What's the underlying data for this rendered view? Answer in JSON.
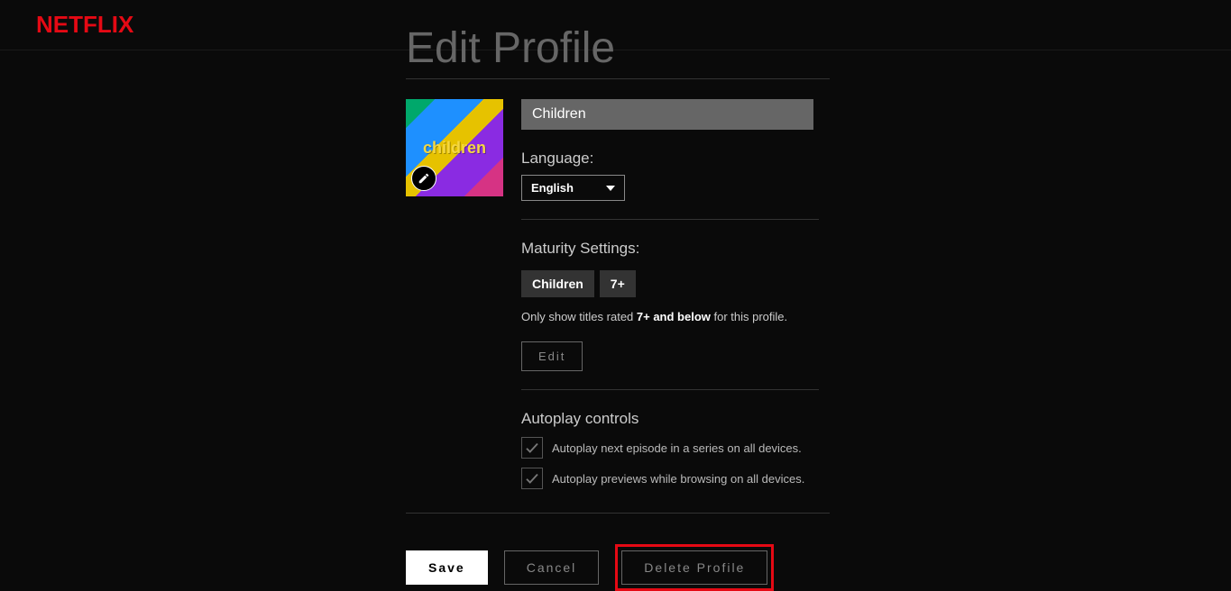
{
  "brand": "NETFLIX",
  "page_title": "Edit Profile",
  "avatar_label": "children",
  "profile_name": "Children",
  "language": {
    "label": "Language:",
    "selected": "English"
  },
  "maturity": {
    "label": "Maturity Settings:",
    "badges": [
      "Children",
      "7+"
    ],
    "desc_prefix": "Only show titles rated ",
    "desc_bold": "7+ and below",
    "desc_suffix": " for this profile.",
    "edit_label": "Edit"
  },
  "autoplay": {
    "label": "Autoplay controls",
    "options": [
      "Autoplay next episode in a series on all devices.",
      "Autoplay previews while browsing on all devices."
    ]
  },
  "buttons": {
    "save": "Save",
    "cancel": "Cancel",
    "delete": "Delete Profile"
  }
}
